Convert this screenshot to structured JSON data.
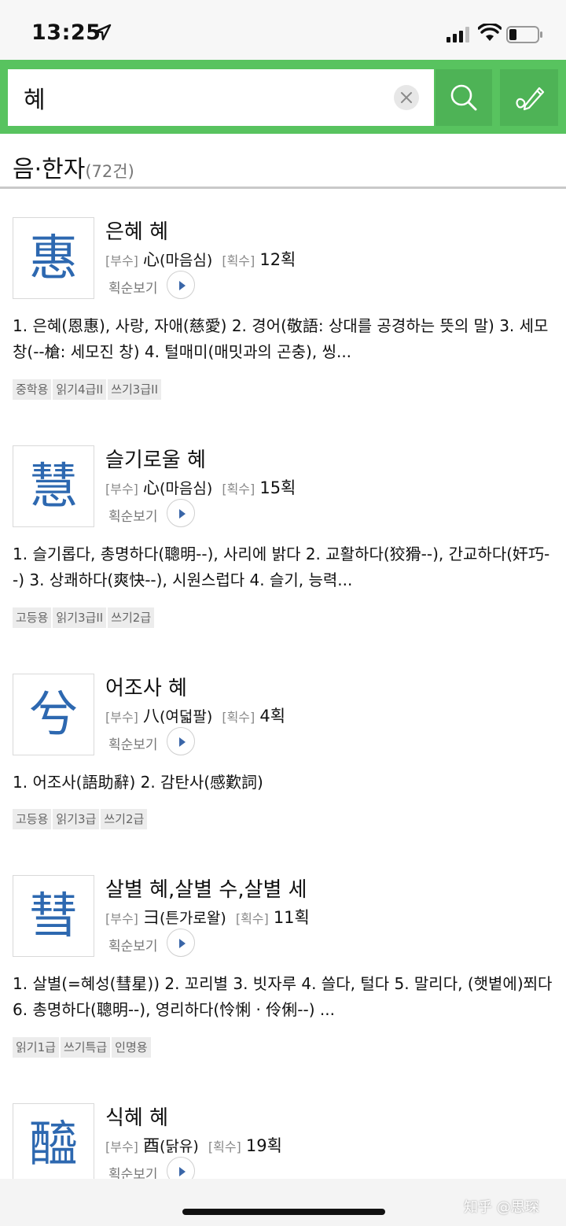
{
  "status_bar": {
    "time": "13:25"
  },
  "search": {
    "value": "혜",
    "placeholder": ""
  },
  "section": {
    "title": "음·한자",
    "count": "(72건)"
  },
  "labels": {
    "radical": "[부수]",
    "strokes": "[획수]",
    "stroke_order": "획순보기"
  },
  "entries": [
    {
      "char": "惠",
      "reading": "은혜 혜",
      "radical": "心",
      "radical_name": "(마음심)",
      "strokes": "12획",
      "desc": "1. 은혜(恩惠), 사랑, 자애(慈愛) 2. 경어(敬語: 상대를 공경하는 뜻의 말) 3. 세모창(--槍: 세모진 창) 4. 털매미(매밋과의 곤충), 씽...",
      "tags": [
        "중학용",
        "읽기4급II",
        "쓰기3급II"
      ]
    },
    {
      "char": "慧",
      "reading": "슬기로울 혜",
      "radical": "心",
      "radical_name": "(마음심)",
      "strokes": "15획",
      "desc": "1. 슬기롭다, 총명하다(聰明--), 사리에 밝다 2. 교활하다(狡猾--), 간교하다(奸巧--) 3. 상쾌하다(爽快--), 시원스럽다 4. 슬기, 능력...",
      "tags": [
        "고등용",
        "읽기3급II",
        "쓰기2급"
      ]
    },
    {
      "char": "兮",
      "reading": "어조사 혜",
      "radical": "八",
      "radical_name": "(여덟팔)",
      "strokes": "4획",
      "desc": "1. 어조사(語助辭) 2. 감탄사(感歎詞)",
      "tags": [
        "고등용",
        "읽기3급",
        "쓰기2급"
      ]
    },
    {
      "char": "彗",
      "reading": "살별 혜,살별 수,살별 세",
      "radical": "彐",
      "radical_name": "(튼가로왈)",
      "strokes": "11획",
      "desc": "1. 살별(=혜성(彗星)) 2. 꼬리별 3. 빗자루 4. 쓸다, 털다 5. 말리다, (햇볕에)쬐다 6. 총명하다(聰明--), 영리하다(怜悧 · 伶俐--) ...",
      "tags": [
        "읽기1급",
        "쓰기특급",
        "인명용"
      ]
    },
    {
      "char": "醯",
      "reading": "식혜 혜",
      "radical": "酉",
      "radical_name": "(닭유)",
      "strokes": "19획",
      "desc": "",
      "tags": []
    }
  ],
  "watermark": "知乎 @思琛",
  "colors": {
    "brand_green": "#58c35f",
    "hanja_blue": "#2d68b0"
  }
}
